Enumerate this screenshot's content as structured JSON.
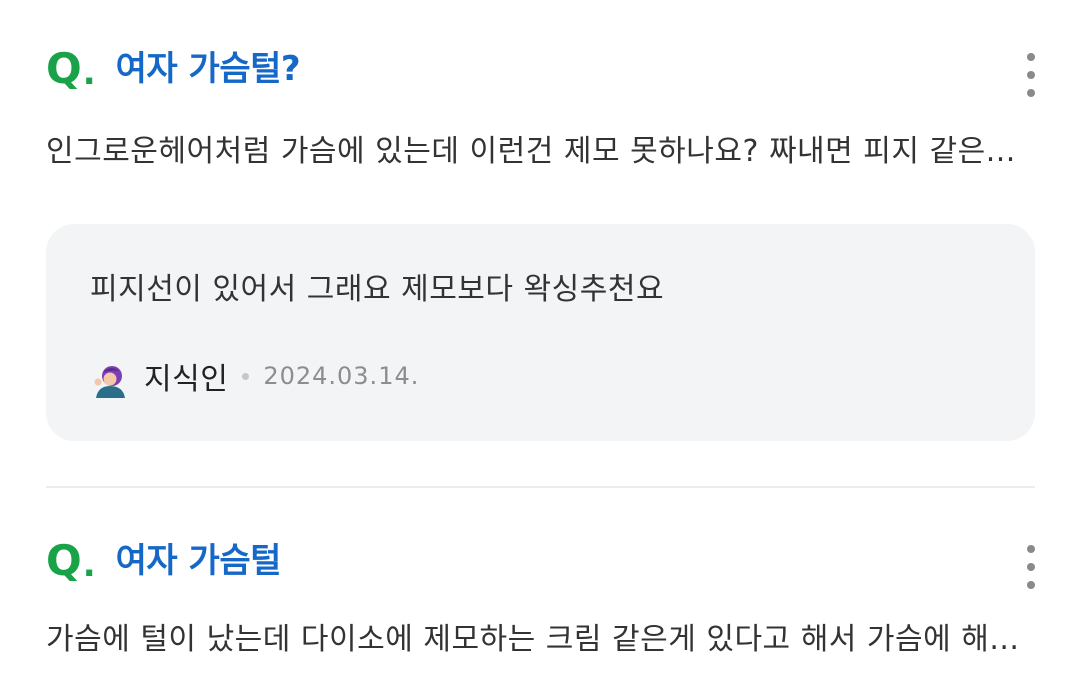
{
  "results": [
    {
      "q_mark": "Q",
      "q_dot": ".",
      "title": "여자 가슴털?",
      "snippet": "인그로운헤어처럼 가슴에 있는데 이런건 제모 못하나요? 짜내면 피지 같은...",
      "answer": {
        "text": "피지선이 있어서 그래요 제모보다 왁싱추천요",
        "author": "지식인",
        "date": "2024.03.14."
      }
    },
    {
      "q_mark": "Q",
      "q_dot": ".",
      "title": "여자 가슴털",
      "snippet": "가슴에 털이 났는데 다이소에 제모하는 크림 같은게 있다고 해서 가슴에 해..."
    }
  ],
  "colors": {
    "q_mark": "#19a248",
    "title": "#1568c7",
    "answer_bg": "#f3f4f6"
  },
  "icons": {
    "more": "kebab-menu-icon",
    "avatar": "avatar-icon"
  }
}
